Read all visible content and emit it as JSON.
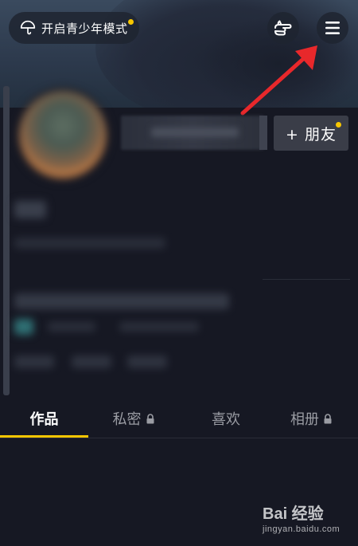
{
  "header": {
    "teen_mode_label": "开启青少年模式",
    "hand_icon": "pointing-hand-icon",
    "menu_icon": "hamburger-menu-icon"
  },
  "profile": {
    "add_friend_label": "+ 朋友"
  },
  "tabs": [
    {
      "label": "作品",
      "locked": false,
      "active": true
    },
    {
      "label": "私密",
      "locked": true,
      "active": false
    },
    {
      "label": "喜欢",
      "locked": false,
      "active": false
    },
    {
      "label": "相册",
      "locked": true,
      "active": false
    }
  ],
  "watermark": {
    "brand": "Bai 经验",
    "url": "jingyan.baidu.com"
  },
  "colors": {
    "accent": "#f7c600",
    "background": "#161823",
    "annotation_arrow": "#e8282b"
  }
}
